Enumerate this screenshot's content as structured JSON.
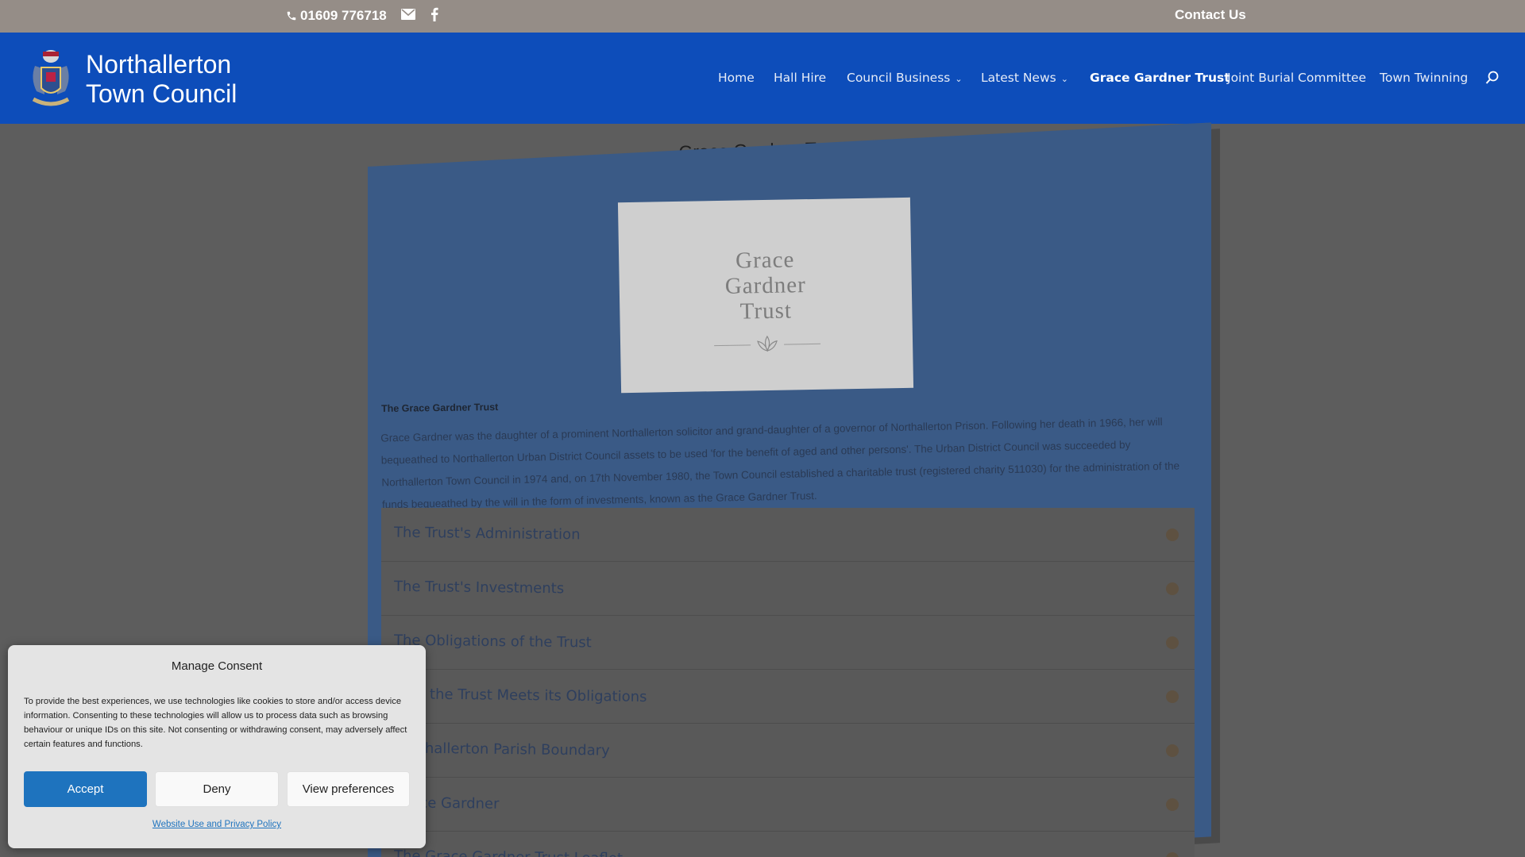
{
  "topbar": {
    "phone": "01609 776718",
    "contact_label": "Contact Us",
    "icons": [
      "phone-icon",
      "mail-icon",
      "facebook-icon"
    ]
  },
  "header": {
    "brand_line1": "Northallerton",
    "brand_line2": "Town Council",
    "nav": [
      {
        "label": "Home"
      },
      {
        "label": "Hall Hire"
      },
      {
        "label": "Council Business"
      },
      {
        "label": "Latest News"
      },
      {
        "label": "Grace Gardner Trust"
      },
      {
        "label": "Joint Burial Committee"
      },
      {
        "label": "Town Twinning"
      }
    ],
    "colors": {
      "bar": "#0d4dba",
      "topbar": "#958d87"
    }
  },
  "main": {
    "title": "Grace Gardner Trust",
    "hero_words": [
      "Grace",
      "Gardner",
      "Trust"
    ],
    "intro_heading": "The Grace Gardner Trust",
    "intro_text": "Grace Gardner was the daughter of a prominent Northallerton solicitor and grand-daughter of a governor of Northallerton Prison. Following her death in 1966, her will bequeathed to Northallerton Urban District Council assets to be used 'for the benefit of aged and other persons'. The Urban District Council was succeeded by Northallerton Town Council in 1974 and, on 17th November 1980, the Town Council established a charitable trust (registered charity 511030) for the administration of the funds bequeathed by the will in the form of investments, known as the Grace Gardner Trust.",
    "accordion": [
      {
        "title": "The Trust's Administration"
      },
      {
        "title": "The Trust's Investments"
      },
      {
        "title": "The Obligations of the Trust"
      },
      {
        "title": "How the Trust Meets its Obligations"
      },
      {
        "title": "Northallerton Parish Boundary"
      },
      {
        "title": "Grace Gardner"
      },
      {
        "title": "The Grace Gardner Trust Leaflet"
      }
    ]
  },
  "consent": {
    "title": "Manage Consent",
    "text": "To provide the best experiences, we use technologies like cookies to store and/or access device information. Consenting to these technologies will allow us to process data such as browsing behaviour or unique IDs on this site. Not consenting or withdrawing consent, may adversely affect certain features and functions.",
    "accept_label": "Accept",
    "deny_label": "Deny",
    "prefs_label": "View preferences",
    "link_label": "Website Use and Privacy Policy",
    "accent": "#1e73be"
  }
}
